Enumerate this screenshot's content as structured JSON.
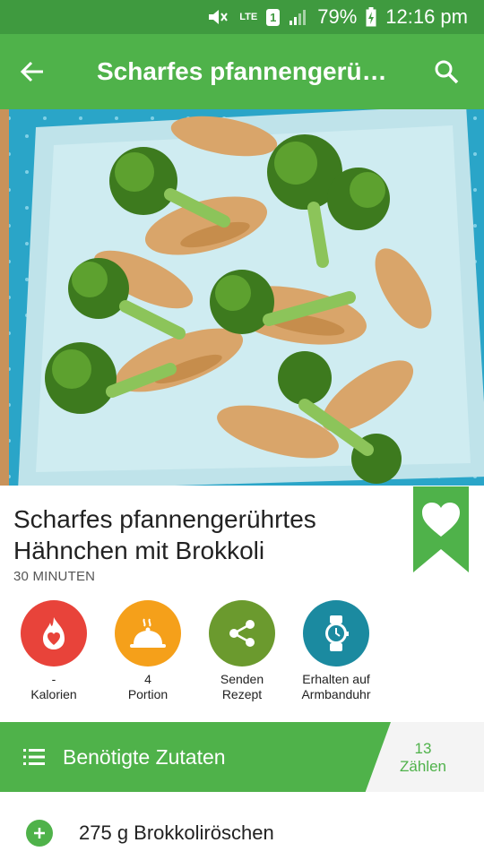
{
  "status_bar": {
    "network": "LTE",
    "sim": "1",
    "battery_percent": "79%",
    "time": "12:16 pm"
  },
  "app_bar": {
    "title": "Scharfes pfannengerü…"
  },
  "hero": {
    "description_icon": "food-photo"
  },
  "recipe": {
    "title_line1": "Scharfes pfannengerührtes",
    "title_line2": "Hähnchen mit Brokkoli",
    "time": "30 MINUTEN"
  },
  "actions": [
    {
      "value": "-",
      "label": "Kalorien",
      "color": "#e8433a",
      "icon": "flame-heart-icon"
    },
    {
      "value": "4",
      "label": "Portion",
      "color": "#f5a01a",
      "icon": "cloche-icon"
    },
    {
      "value": "",
      "label_line1": "Senden",
      "label_line2": "Rezept",
      "color": "#6b9a2e",
      "icon": "share-icon"
    },
    {
      "value": "",
      "label_line1": "Erhalten auf",
      "label_line2": "Armbanduhr",
      "color": "#1b8aa0",
      "icon": "watch-icon"
    }
  ],
  "ingredients": {
    "heading": "Benötigte Zutaten",
    "count": "13",
    "count_label": "Zählen",
    "items": [
      {
        "text": "275 g Brokkoliröschen"
      }
    ]
  },
  "colors": {
    "brand_green": "#4fb24a",
    "status_green": "#3f9a3f"
  }
}
